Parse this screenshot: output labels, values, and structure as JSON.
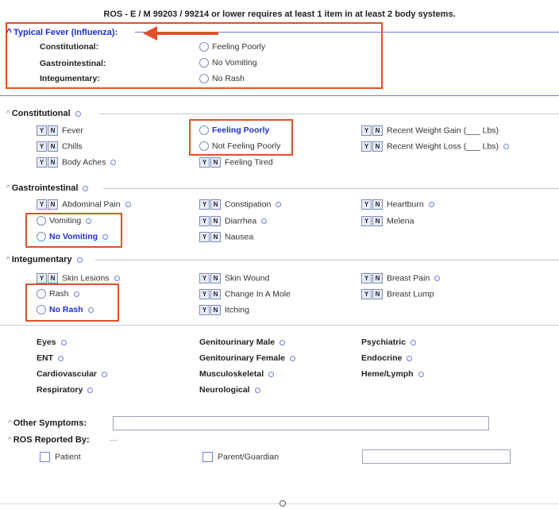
{
  "header": {
    "text": "ROS - E / M 99203 / 99214 or lower requires at least 1 item in at least 2 body systems."
  },
  "typical": {
    "title": "Typical Fever (Influenza):",
    "rows": [
      {
        "label": "Constitutional:",
        "value": "Feeling Poorly"
      },
      {
        "label": "Gastrointestinal:",
        "value": "No Vomiting"
      },
      {
        "label": "Integumentary:",
        "value": "No Rash"
      }
    ]
  },
  "constitutional": {
    "title": "Constitutional",
    "col1": [
      "Fever",
      "Chills",
      "Body Aches"
    ],
    "radio_feeling_poorly": "Feeling Poorly",
    "radio_not_feeling_poorly": "Not Feeling Poorly",
    "feeling_tired": "Feeling Tired",
    "col3": [
      "Recent Weight Gain (___ Lbs)",
      "Recent Weight Loss (___ Lbs)"
    ]
  },
  "gastro": {
    "title": "Gastrointestinal",
    "abdominal_pain": "Abdominal Pain",
    "radio_vomiting": "Vomiting",
    "radio_no_vomiting": "No Vomiting",
    "col2": [
      "Constipation",
      "Diarrhea",
      "Nausea"
    ],
    "col3": [
      "Heartburn",
      "Melena"
    ]
  },
  "integ": {
    "title": "Integumentary",
    "skin_lesions": "Skin Lesions",
    "radio_rash": "Rash",
    "radio_no_rash": "No Rash",
    "col2": [
      "Skin Wound",
      "Change In A Mole",
      "Itching"
    ],
    "col3": [
      "Breast Pain",
      "Breast Lump"
    ]
  },
  "systems": {
    "col1": [
      "Eyes",
      "ENT",
      "Cardiovascular",
      "Respiratory"
    ],
    "col2": [
      "Genitourinary Male",
      "Genitourinary Female",
      "Musculoskeletal",
      "Neurological"
    ],
    "col3": [
      "Psychiatric",
      "Endocrine",
      "Heme/Lymph"
    ]
  },
  "yn": {
    "y": "Y",
    "n": "N"
  },
  "other_symptoms": {
    "label": "Other Symptoms:",
    "value": ""
  },
  "ros_reported": {
    "label": "ROS Reported By:",
    "patient": "Patient",
    "parent": "Parent/Guardian",
    "other_value": ""
  },
  "colors": {
    "accent": "#1f2fd6",
    "annotation": "#e0502a"
  }
}
